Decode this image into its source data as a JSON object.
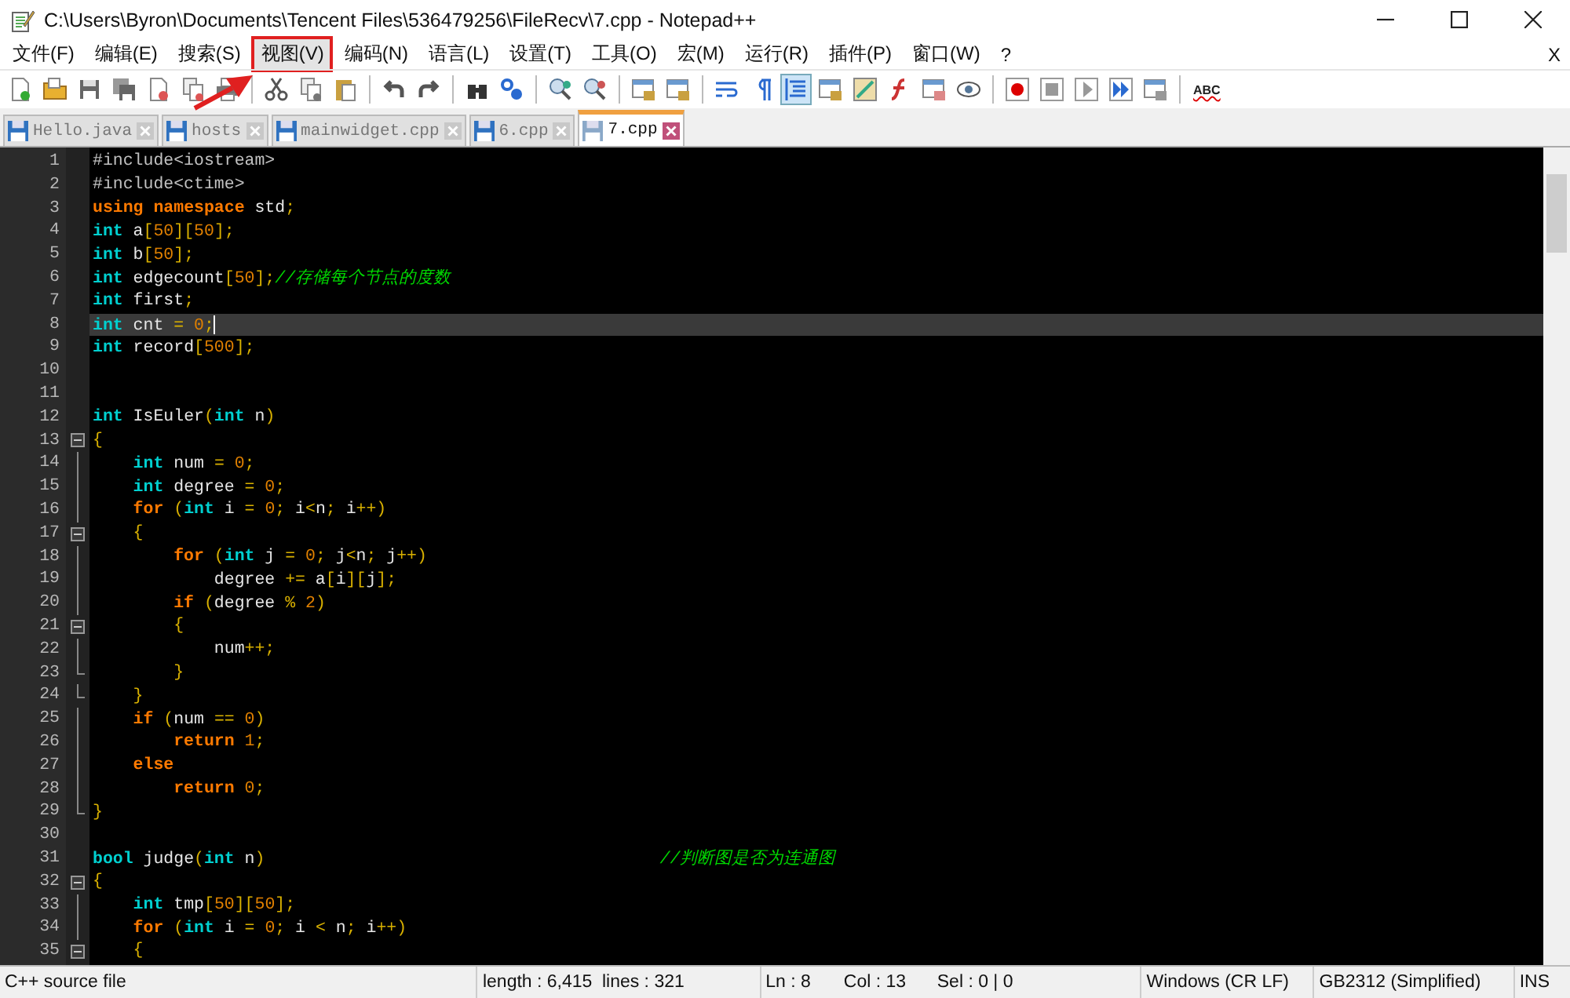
{
  "window": {
    "title": "C:\\Users\\Byron\\Documents\\Tencent Files\\536479256\\FileRecv\\7.cpp - Notepad++"
  },
  "menu": [
    {
      "label": "文件(F)",
      "annotated": false
    },
    {
      "label": "编辑(E)",
      "annotated": false
    },
    {
      "label": "搜索(S)",
      "annotated": false
    },
    {
      "label": "视图(V)",
      "annotated": true
    },
    {
      "label": "编码(N)",
      "annotated": false
    },
    {
      "label": "语言(L)",
      "annotated": false
    },
    {
      "label": "设置(T)",
      "annotated": false
    },
    {
      "label": "工具(O)",
      "annotated": false
    },
    {
      "label": "宏(M)",
      "annotated": false
    },
    {
      "label": "运行(R)",
      "annotated": false
    },
    {
      "label": "插件(P)",
      "annotated": false
    },
    {
      "label": "窗口(W)",
      "annotated": false
    },
    {
      "label": "?",
      "annotated": false
    }
  ],
  "menu_close": "X",
  "toolbar": {
    "spellcheck_label": "ABC"
  },
  "tabs": [
    {
      "label": "Hello.java",
      "selected": false
    },
    {
      "label": "hosts",
      "selected": false
    },
    {
      "label": "mainwidget.cpp",
      "selected": false
    },
    {
      "label": "6.cpp",
      "selected": false
    },
    {
      "label": "7.cpp",
      "selected": true
    }
  ],
  "editor": {
    "lines": [
      {
        "number": "1",
        "current": false,
        "kind": "plain",
        "tokens": [
          {
            "kind": "pre",
            "text": "#include<iostream>"
          }
        ]
      },
      {
        "number": "2",
        "current": false,
        "kind": "plain",
        "tokens": [
          {
            "kind": "pre",
            "text": "#include<ctime>"
          }
        ]
      },
      {
        "number": "3",
        "current": false,
        "kind": "plain",
        "tokens": [
          {
            "kind": "kw",
            "text": "using"
          },
          {
            "kind": "kw",
            "text": " namespace"
          },
          {
            "kind": "txt",
            "text": " std"
          },
          {
            "kind": "op",
            "text": ";"
          }
        ]
      },
      {
        "number": "4",
        "current": false,
        "kind": "plain",
        "tokens": [
          {
            "kind": "type",
            "text": "int"
          },
          {
            "kind": "txt",
            "text": " a"
          },
          {
            "kind": "op",
            "text": "["
          },
          {
            "kind": "num",
            "text": "50"
          },
          {
            "kind": "op",
            "text": "]["
          },
          {
            "kind": "num",
            "text": "50"
          },
          {
            "kind": "op",
            "text": "];"
          }
        ]
      },
      {
        "number": "5",
        "current": false,
        "kind": "plain",
        "tokens": [
          {
            "kind": "type",
            "text": "int"
          },
          {
            "kind": "txt",
            "text": " b"
          },
          {
            "kind": "op",
            "text": "["
          },
          {
            "kind": "num",
            "text": "50"
          },
          {
            "kind": "op",
            "text": "];"
          }
        ]
      },
      {
        "number": "6",
        "current": false,
        "kind": "plain",
        "tokens": [
          {
            "kind": "type",
            "text": "int"
          },
          {
            "kind": "txt",
            "text": " edgecount"
          },
          {
            "kind": "op",
            "text": "["
          },
          {
            "kind": "num",
            "text": "50"
          },
          {
            "kind": "op",
            "text": "];"
          },
          {
            "kind": "com",
            "text": "//存储每个节点的度数"
          }
        ]
      },
      {
        "number": "7",
        "current": false,
        "kind": "plain",
        "tokens": [
          {
            "kind": "type",
            "text": "int"
          },
          {
            "kind": "txt",
            "text": " first"
          },
          {
            "kind": "op",
            "text": ";"
          }
        ]
      },
      {
        "number": "8",
        "current": true,
        "kind": "plain",
        "tokens": [
          {
            "kind": "type",
            "text": "int"
          },
          {
            "kind": "txt",
            "text": " cnt "
          },
          {
            "kind": "op",
            "text": "="
          },
          {
            "kind": "num",
            "text": " 0"
          },
          {
            "kind": "op",
            "text": ";"
          }
        ]
      },
      {
        "number": "9",
        "current": false,
        "kind": "plain",
        "tokens": [
          {
            "kind": "type",
            "text": "int"
          },
          {
            "kind": "txt",
            "text": " record"
          },
          {
            "kind": "op",
            "text": "["
          },
          {
            "kind": "num",
            "text": "500"
          },
          {
            "kind": "op",
            "text": "];"
          }
        ]
      },
      {
        "number": "10",
        "current": false,
        "kind": "plain"
      },
      {
        "number": "11",
        "current": false,
        "kind": "plain"
      },
      {
        "number": "12",
        "current": false,
        "kind": "plain",
        "tokens": [
          {
            "kind": "type",
            "text": "int"
          },
          {
            "kind": "txt",
            "text": " IsEuler"
          },
          {
            "kind": "op",
            "text": "("
          },
          {
            "kind": "type",
            "text": "int"
          },
          {
            "kind": "txt",
            "text": " n"
          },
          {
            "kind": "op",
            "text": ")"
          }
        ]
      },
      {
        "number": "13",
        "current": false,
        "kind": "fold_open",
        "tokens": [
          {
            "kind": "op",
            "text": "{"
          }
        ]
      },
      {
        "number": "14",
        "current": false,
        "kind": "fold_body",
        "tokens": [
          {
            "kind": "type",
            "text": "    int"
          },
          {
            "kind": "txt",
            "text": " num "
          },
          {
            "kind": "op",
            "text": "="
          },
          {
            "kind": "num",
            "text": " 0"
          },
          {
            "kind": "op",
            "text": ";"
          }
        ]
      },
      {
        "number": "15",
        "current": false,
        "kind": "fold_body",
        "tokens": [
          {
            "kind": "type",
            "text": "    int"
          },
          {
            "kind": "txt",
            "text": " degree "
          },
          {
            "kind": "op",
            "text": "="
          },
          {
            "kind": "num",
            "text": " 0"
          },
          {
            "kind": "op",
            "text": ";"
          }
        ]
      },
      {
        "number": "16",
        "current": false,
        "kind": "fold_body",
        "tokens": [
          {
            "kind": "kw",
            "text": "    for"
          },
          {
            "kind": "op",
            "text": " ("
          },
          {
            "kind": "type",
            "text": "int"
          },
          {
            "kind": "txt",
            "text": " i "
          },
          {
            "kind": "op",
            "text": "="
          },
          {
            "kind": "num",
            "text": " 0"
          },
          {
            "kind": "op",
            "text": ";"
          },
          {
            "kind": "txt",
            "text": " i"
          },
          {
            "kind": "op",
            "text": "<"
          },
          {
            "kind": "txt",
            "text": "n"
          },
          {
            "kind": "op",
            "text": ";"
          },
          {
            "kind": "txt",
            "text": " i"
          },
          {
            "kind": "op",
            "text": "++)"
          }
        ]
      },
      {
        "number": "17",
        "current": false,
        "kind": "fold_open",
        "tokens": [
          {
            "kind": "op",
            "text": "    {"
          }
        ]
      },
      {
        "number": "18",
        "current": false,
        "kind": "fold_body",
        "tokens": [
          {
            "kind": "kw",
            "text": "        for"
          },
          {
            "kind": "op",
            "text": " ("
          },
          {
            "kind": "type",
            "text": "int"
          },
          {
            "kind": "txt",
            "text": " j "
          },
          {
            "kind": "op",
            "text": "="
          },
          {
            "kind": "num",
            "text": " 0"
          },
          {
            "kind": "op",
            "text": ";"
          },
          {
            "kind": "txt",
            "text": " j"
          },
          {
            "kind": "op",
            "text": "<"
          },
          {
            "kind": "txt",
            "text": "n"
          },
          {
            "kind": "op",
            "text": ";"
          },
          {
            "kind": "txt",
            "text": " j"
          },
          {
            "kind": "op",
            "text": "++)"
          }
        ]
      },
      {
        "number": "19",
        "current": false,
        "kind": "fold_body",
        "tokens": [
          {
            "kind": "txt",
            "text": "            degree "
          },
          {
            "kind": "op",
            "text": "+="
          },
          {
            "kind": "txt",
            "text": " a"
          },
          {
            "kind": "op",
            "text": "["
          },
          {
            "kind": "txt",
            "text": "i"
          },
          {
            "kind": "op",
            "text": "]["
          },
          {
            "kind": "txt",
            "text": "j"
          },
          {
            "kind": "op",
            "text": "];"
          }
        ]
      },
      {
        "number": "20",
        "current": false,
        "kind": "fold_body",
        "tokens": [
          {
            "kind": "kw",
            "text": "        if"
          },
          {
            "kind": "op",
            "text": " ("
          },
          {
            "kind": "txt",
            "text": "degree "
          },
          {
            "kind": "op",
            "text": "%"
          },
          {
            "kind": "num",
            "text": " 2"
          },
          {
            "kind": "op",
            "text": ")"
          }
        ]
      },
      {
        "number": "21",
        "current": false,
        "kind": "fold_open",
        "tokens": [
          {
            "kind": "op",
            "text": "        {"
          }
        ]
      },
      {
        "number": "22",
        "current": false,
        "kind": "fold_body",
        "tokens": [
          {
            "kind": "txt",
            "text": "            num"
          },
          {
            "kind": "op",
            "text": "++;"
          }
        ]
      },
      {
        "number": "23",
        "current": false,
        "kind": "fold_end",
        "tokens": [
          {
            "kind": "op",
            "text": "        }"
          }
        ]
      },
      {
        "number": "24",
        "current": false,
        "kind": "fold_end",
        "tokens": [
          {
            "kind": "op",
            "text": "    }"
          }
        ]
      },
      {
        "number": "25",
        "current": false,
        "kind": "fold_body",
        "tokens": [
          {
            "kind": "kw",
            "text": "    if"
          },
          {
            "kind": "op",
            "text": " ("
          },
          {
            "kind": "txt",
            "text": "num "
          },
          {
            "kind": "op",
            "text": "=="
          },
          {
            "kind": "num",
            "text": " 0"
          },
          {
            "kind": "op",
            "text": ")"
          }
        ]
      },
      {
        "number": "26",
        "current": false,
        "kind": "fold_body",
        "tokens": [
          {
            "kind": "kw",
            "text": "        return"
          },
          {
            "kind": "num",
            "text": " 1"
          },
          {
            "kind": "op",
            "text": ";"
          }
        ]
      },
      {
        "number": "27",
        "current": false,
        "kind": "fold_body",
        "tokens": [
          {
            "kind": "kw",
            "text": "    else"
          }
        ]
      },
      {
        "number": "28",
        "current": false,
        "kind": "fold_body",
        "tokens": [
          {
            "kind": "kw",
            "text": "        return"
          },
          {
            "kind": "num",
            "text": " 0"
          },
          {
            "kind": "op",
            "text": ";"
          }
        ]
      },
      {
        "number": "29",
        "current": false,
        "kind": "fold_end",
        "tokens": [
          {
            "kind": "op",
            "text": "}"
          }
        ]
      },
      {
        "number": "30",
        "current": false,
        "kind": "plain"
      },
      {
        "number": "31",
        "current": false,
        "kind": "plain",
        "tokens": [
          {
            "kind": "type",
            "text": "bool"
          },
          {
            "kind": "txt",
            "text": " judge"
          },
          {
            "kind": "op",
            "text": "("
          },
          {
            "kind": "type",
            "text": "int"
          },
          {
            "kind": "txt",
            "text": " n"
          },
          {
            "kind": "op",
            "text": ")"
          },
          {
            "kind": "com",
            "text": "                                       //判断图是否为连通图"
          }
        ]
      },
      {
        "number": "32",
        "current": false,
        "kind": "fold_open",
        "tokens": [
          {
            "kind": "op",
            "text": "{"
          }
        ]
      },
      {
        "number": "33",
        "current": false,
        "kind": "fold_body",
        "tokens": [
          {
            "kind": "type",
            "text": "    int"
          },
          {
            "kind": "txt",
            "text": " tmp"
          },
          {
            "kind": "op",
            "text": "["
          },
          {
            "kind": "num",
            "text": "50"
          },
          {
            "kind": "op",
            "text": "]["
          },
          {
            "kind": "num",
            "text": "50"
          },
          {
            "kind": "op",
            "text": "];"
          }
        ]
      },
      {
        "number": "34",
        "current": false,
        "kind": "fold_body",
        "tokens": [
          {
            "kind": "kw",
            "text": "    for"
          },
          {
            "kind": "op",
            "text": " ("
          },
          {
            "kind": "type",
            "text": "int"
          },
          {
            "kind": "txt",
            "text": " i "
          },
          {
            "kind": "op",
            "text": "="
          },
          {
            "kind": "num",
            "text": " 0"
          },
          {
            "kind": "op",
            "text": ";"
          },
          {
            "kind": "txt",
            "text": " i "
          },
          {
            "kind": "op",
            "text": "<"
          },
          {
            "kind": "txt",
            "text": " n"
          },
          {
            "kind": "op",
            "text": ";"
          },
          {
            "kind": "txt",
            "text": " i"
          },
          {
            "kind": "op",
            "text": "++)"
          }
        ]
      },
      {
        "number": "35",
        "current": false,
        "kind": "fold_open",
        "tokens": [
          {
            "kind": "op",
            "text": "    {"
          }
        ]
      }
    ]
  },
  "status_bar": {
    "file_type": "C++ source file",
    "length": "length : 6,415",
    "lines": "lines : 321",
    "ln": "Ln : 8",
    "col": "Col : 13",
    "sel": "Sel : 0 | 0",
    "eol": "Windows (CR LF)",
    "encoding": "GB2312 (Simplified)",
    "mode": "INS"
  }
}
